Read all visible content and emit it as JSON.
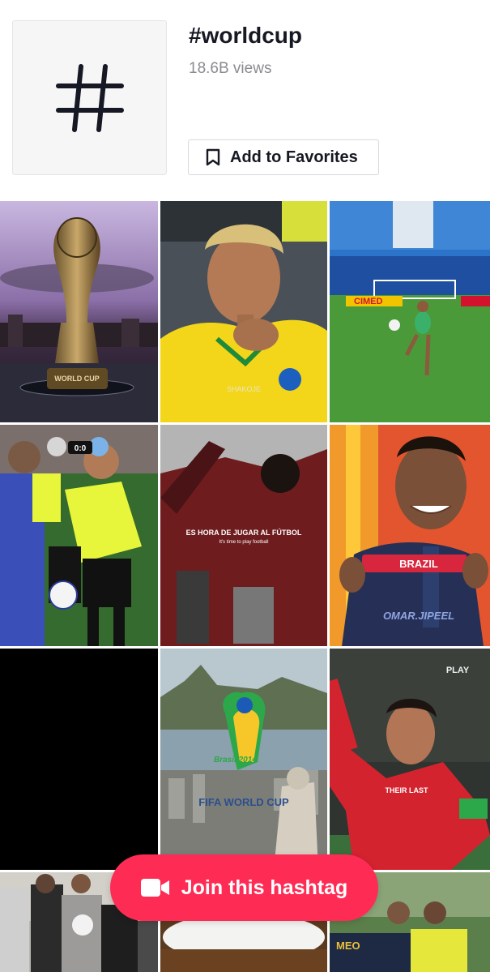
{
  "hashtag": {
    "title": "#worldcup",
    "views": "18.6B views",
    "favorite_label": "Add to Favorites"
  },
  "videos": [
    {
      "caption": "WORLD CUP",
      "overlay": ""
    },
    {
      "caption": "",
      "overlay": "SHAKOJE"
    },
    {
      "caption": "",
      "overlay": "CIMED"
    },
    {
      "caption": "",
      "overlay": "0:0"
    },
    {
      "caption": "ES HORA DE JUGAR AL FÚTBOL",
      "overlay": "It's time to play football"
    },
    {
      "caption": "BRAZIL",
      "overlay": "OMAR.JIPEEL"
    },
    {
      "caption": "",
      "overlay": ""
    },
    {
      "caption": "FIFA WORLD CUP",
      "overlay": "Brasil 2014"
    },
    {
      "caption": "THEIR LAST",
      "overlay": "PLAY"
    },
    {
      "caption": "",
      "overlay": ""
    },
    {
      "caption": "",
      "overlay": ""
    },
    {
      "caption": "",
      "overlay": ""
    }
  ],
  "join_button": {
    "label": "Join this hashtag"
  },
  "colors": {
    "accent": "#fe2c55",
    "text": "#161823",
    "muted": "#8a8b91"
  },
  "icons": {
    "hashtag": "hashtag-icon",
    "bookmark": "bookmark-icon",
    "camera": "video-camera-icon"
  }
}
